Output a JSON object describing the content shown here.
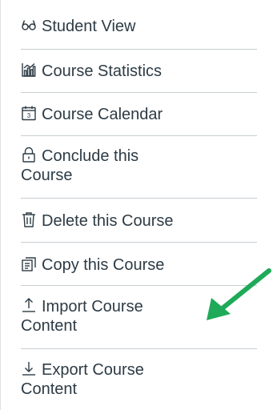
{
  "menu": {
    "items": [
      {
        "label": "Student View",
        "icon": "glasses-icon"
      },
      {
        "label": "Course Statistics",
        "icon": "bar-chart-icon"
      },
      {
        "label": "Course Calendar",
        "icon": "calendar-icon",
        "calendar_day": "3"
      },
      {
        "label": "Conclude this Course",
        "icon": "lock-icon"
      },
      {
        "label": "Delete this Course",
        "icon": "trash-icon"
      },
      {
        "label": "Copy this Course",
        "icon": "copy-icon"
      },
      {
        "label": "Import Course Content",
        "icon": "upload-icon"
      },
      {
        "label": "Export Course Content",
        "icon": "download-icon"
      }
    ]
  },
  "colors": {
    "text": "#2d3b45",
    "divider": "#c7cdd1",
    "annotation_arrow": "#1faa59"
  }
}
